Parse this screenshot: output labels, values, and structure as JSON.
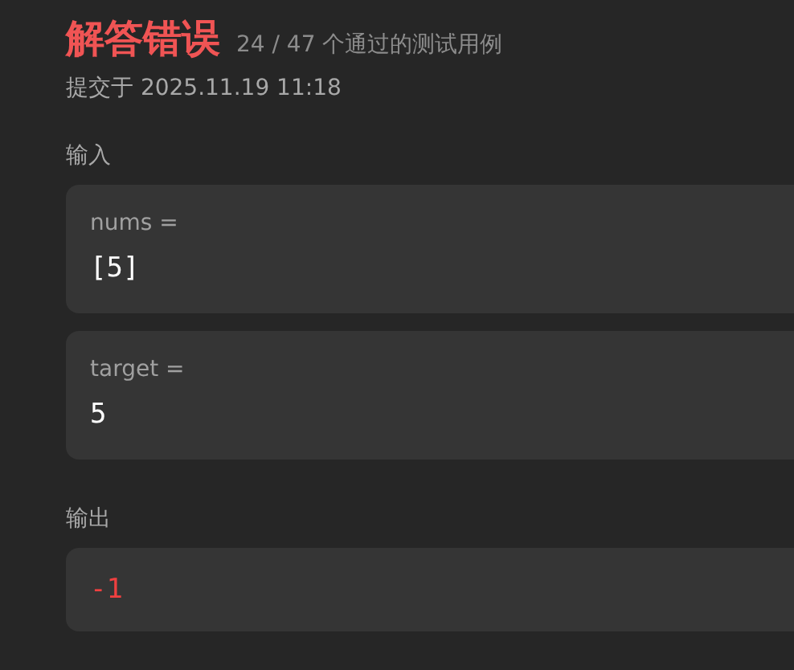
{
  "result": {
    "title": "解答错误",
    "summary": "24 / 47 个通过的测试用例",
    "submitted": "提交于 2025.11.19 11:18"
  },
  "input": {
    "label": "输入",
    "params": [
      {
        "name": "nums =",
        "value": "[5]"
      },
      {
        "name": "target =",
        "value": "5"
      }
    ]
  },
  "output": {
    "label": "输出",
    "value": "-1"
  }
}
